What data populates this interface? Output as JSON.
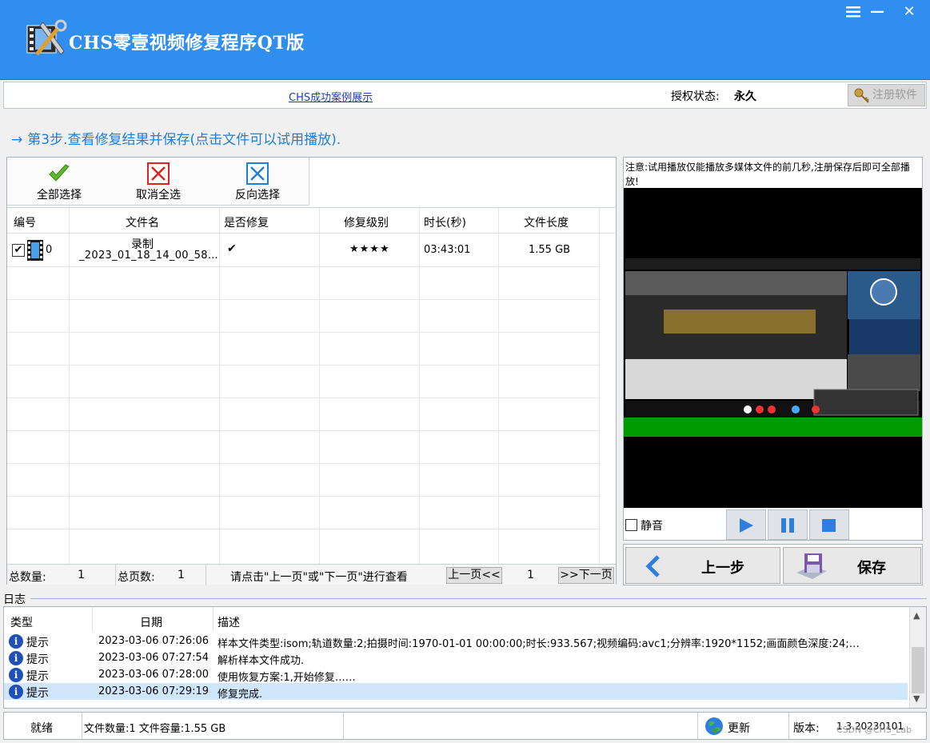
{
  "window": {
    "title": "CHS零壹视频修复程序QT版",
    "menu_icon": "hamburger-icon",
    "min_label": "—",
    "close_label": "✕"
  },
  "infobar": {
    "case_link": "CHS成功案例展示",
    "auth_label": "授权状态:",
    "auth_value": "永久",
    "register_button": "注册软件"
  },
  "step": {
    "arrow": "→",
    "text": "第3步.查看修复结果并保存(点击文件可以试用播放)."
  },
  "toolbar": {
    "select_all": "全部选择",
    "deselect_all": "取消全选",
    "invert_select": "反向选择"
  },
  "table": {
    "columns": [
      "编号",
      "文件名",
      "是否修复",
      "修复级别",
      "时长(秒)",
      "文件长度"
    ],
    "rows": [
      {
        "checked": "✔",
        "id": "0",
        "name_line1": "录制",
        "name_line2": "_2023_01_18_14_00_58…",
        "repaired": "✔",
        "level": "★★★★",
        "duration": "03:43:01",
        "size": "1.55 GB"
      }
    ]
  },
  "pager": {
    "total_count_label": "总数量:",
    "total_count": "1",
    "total_pages_label": "总页数:",
    "total_pages": "1",
    "hint": "请点击\"上一页\"或\"下一页\"进行查看",
    "prev_button": "上一页<<",
    "current_page": "1",
    "next_button": ">>下一页"
  },
  "preview": {
    "notice": "注意:试用播放仅能播放多媒体文件的前几秒,注册保存后即可全部播放!",
    "mute_label": "静音"
  },
  "nav": {
    "back_button": "上一步",
    "save_button": "保存"
  },
  "log": {
    "label": "日志",
    "columns": [
      "类型",
      "日期",
      "描述"
    ],
    "rows": [
      {
        "type": "提示",
        "date": "2023-03-06 07:26:06",
        "desc": "样本文件类型:isom;轨道数量:2;拍摄时间:1970-01-01 00:00:00;时长:933.567;视频编码:avc1;分辨率:1920*1152;画面颜色深度:24;…"
      },
      {
        "type": "提示",
        "date": "2023-03-06 07:27:54",
        "desc": "解析样本文件成功."
      },
      {
        "type": "提示",
        "date": "2023-03-06 07:28:00",
        "desc": "使用恢复方案:1,开始修复……"
      },
      {
        "type": "提示",
        "date": "2023-03-06 07:29:19",
        "desc": "修复完成."
      }
    ]
  },
  "status": {
    "ready": "就绪",
    "file_info": "文件数量:1 文件容量:1.55 GB",
    "update_button": "更新",
    "version_label": "版本:",
    "version": "1.3.20230101",
    "watermark": "CSDN @CHS_Lab"
  },
  "colors": {
    "titlebar": "#2f8ef0",
    "accent_blue": "#1f7fd8",
    "select_row": "#cfe6fb"
  }
}
